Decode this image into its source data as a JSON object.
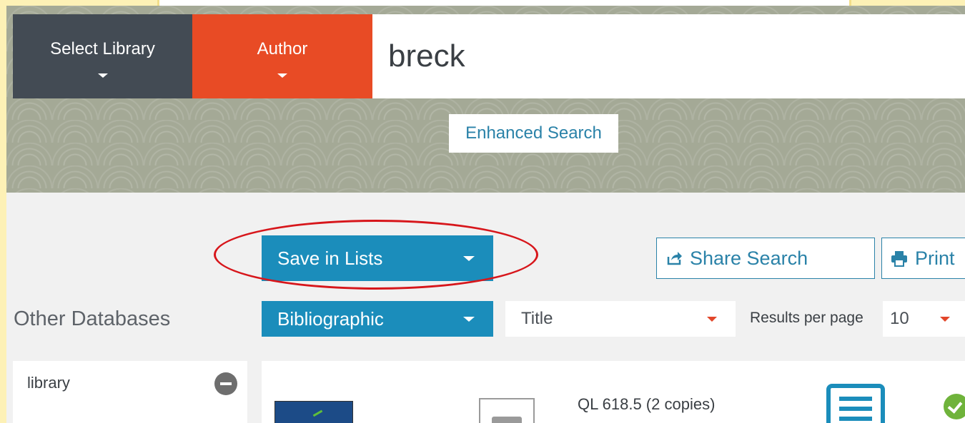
{
  "search_bar": {
    "library_label": "Select Library",
    "search_type_label": "Author",
    "query": "breck",
    "enhanced_search_label": "Enhanced Search"
  },
  "actions": {
    "save_in_lists_label": "Save in Lists",
    "share_search_label": "Share Search",
    "print_label": "Print"
  },
  "filters": {
    "display_format": "Bibliographic",
    "sort_by": "Title",
    "results_per_page_label": "Results per page",
    "results_per_page_value": "10"
  },
  "sidebar": {
    "heading": "Other Databases",
    "panel_label": "library"
  },
  "results": [
    {
      "call_number": "QL 618.5 (2 copies)"
    }
  ],
  "colors": {
    "library_dropdown": "#434b54",
    "author_dropdown": "#e84b25",
    "primary_blue": "#1b8dbb",
    "annotation_red": "#d7161b",
    "available_green": "#6fb33b"
  },
  "icons": [
    "share-icon",
    "print-icon",
    "minus-circle-icon",
    "book-format-icon",
    "details-icon",
    "available-check-icon"
  ]
}
